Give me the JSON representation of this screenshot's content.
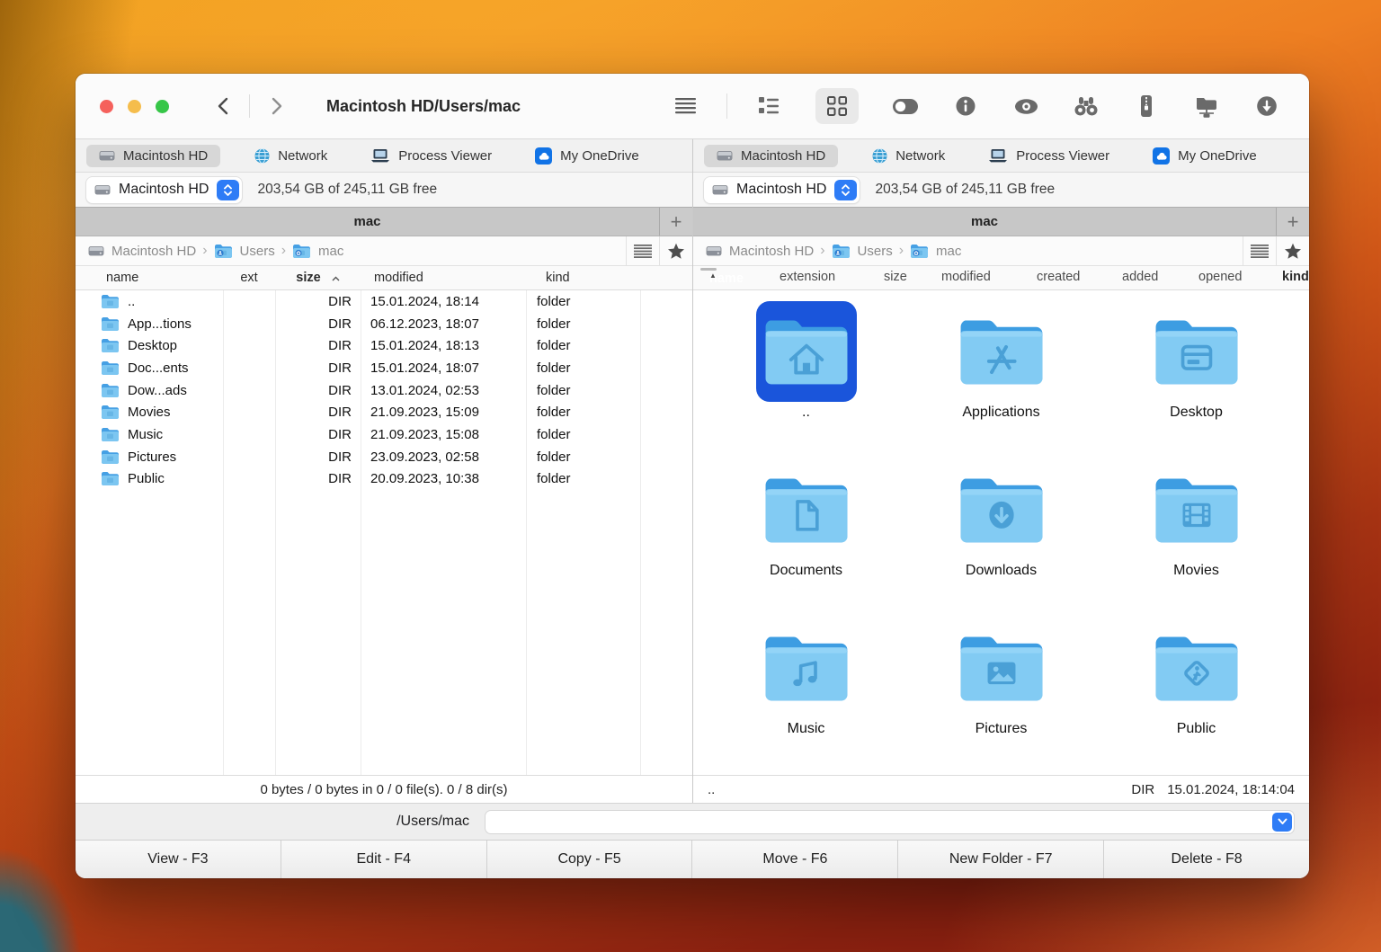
{
  "window": {
    "title": "Macintosh HD/Users/mac"
  },
  "shared": {
    "tabs": [
      "Macintosh HD",
      "Network",
      "Process Viewer",
      "My OneDrive"
    ],
    "drive_name": "Macintosh HD",
    "drive_free": "203,54 GB of 245,11 GB free",
    "folder_tab": "mac",
    "breadcrumb": [
      "Macintosh HD",
      "Users",
      "mac"
    ]
  },
  "left": {
    "columns": [
      "name",
      "ext",
      "size",
      "modified",
      "kind"
    ],
    "rows": [
      {
        "name": "..",
        "size": "DIR",
        "modified": "15.01.2024, 18:14",
        "kind": "folder"
      },
      {
        "name": "App...tions",
        "size": "DIR",
        "modified": "06.12.2023, 18:07",
        "kind": "folder"
      },
      {
        "name": "Desktop",
        "size": "DIR",
        "modified": "15.01.2024, 18:13",
        "kind": "folder"
      },
      {
        "name": "Doc...ents",
        "size": "DIR",
        "modified": "15.01.2024, 18:07",
        "kind": "folder"
      },
      {
        "name": "Dow...ads",
        "size": "DIR",
        "modified": "13.01.2024, 02:53",
        "kind": "folder"
      },
      {
        "name": "Movies",
        "size": "DIR",
        "modified": "21.09.2023, 15:09",
        "kind": "folder"
      },
      {
        "name": "Music",
        "size": "DIR",
        "modified": "21.09.2023, 15:08",
        "kind": "folder"
      },
      {
        "name": "Pictures",
        "size": "DIR",
        "modified": "23.09.2023, 02:58",
        "kind": "folder"
      },
      {
        "name": "Public",
        "size": "DIR",
        "modified": "20.09.2023, 10:38",
        "kind": "folder"
      }
    ],
    "status": "0 bytes / 0 bytes in 0 / 0 file(s). 0 / 8 dir(s)"
  },
  "right": {
    "columns": [
      "name",
      "extension",
      "size",
      "modified",
      "created",
      "added",
      "opened",
      "kind"
    ],
    "items": [
      {
        "label": ".."
      },
      {
        "label": "Applications"
      },
      {
        "label": "Desktop"
      },
      {
        "label": "Documents"
      },
      {
        "label": "Downloads"
      },
      {
        "label": "Movies"
      },
      {
        "label": "Music"
      },
      {
        "label": "Pictures"
      },
      {
        "label": "Public"
      }
    ],
    "status_name": "..",
    "status_size": "DIR",
    "status_modified": "15.01.2024, 18:14:04"
  },
  "command": {
    "label": "/Users/mac",
    "value": ""
  },
  "fkeys": [
    "View - F3",
    "Edit - F4",
    "Copy - F5",
    "Move - F6",
    "New Folder - F7",
    "Delete - F8"
  ],
  "colors": {
    "accent": "#2e7cf6",
    "selection": "#1a55db",
    "folder_body": "#82cbf3",
    "folder_back": "#3d9de2"
  }
}
